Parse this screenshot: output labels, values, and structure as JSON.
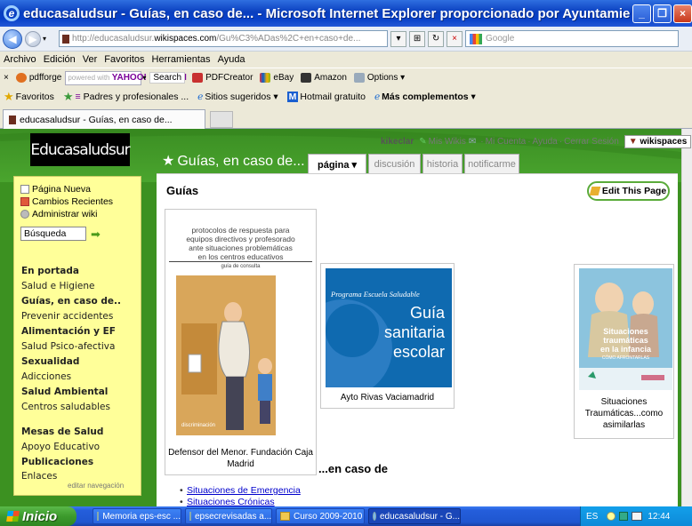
{
  "window": {
    "title": "educasaludsur - Guías, en caso de... - Microsoft Internet Explorer proporcionado por Ayuntamiento ..."
  },
  "address_bar": {
    "url_prefix": "http://educasaludsur.",
    "url_domain": "wikispaces.com",
    "url_rest": "/Gu%C3%ADas%2C+en+caso+de...",
    "search_placeholder": "Google"
  },
  "menu": [
    "Archivo",
    "Edición",
    "Ver",
    "Favoritos",
    "Herramientas",
    "Ayuda"
  ],
  "toolbar": {
    "close_glyph": "×",
    "pdfforge": "pdfforge",
    "yahoo_search_hint": "powered with",
    "yahoo_brand": "YAHOO! SEARCH",
    "search_button": "Search",
    "pdfcreator": "PDFCreator",
    "ebay": "eBay",
    "amazon": "Amazon",
    "options": "Options"
  },
  "favorites_bar": {
    "favoritos": "Favoritos",
    "padres": "Padres y profesionales ...",
    "sitios": "Sitios sugeridos",
    "hotmail": "Hotmail gratuito",
    "mas": "Más complementos"
  },
  "browser_tab": {
    "label": "educasaludsur - Guías, en caso de..."
  },
  "site": {
    "logo": "Educasaludsur",
    "username": "kikeclar",
    "links": [
      "Mis Wikis",
      "Mi Cuenta",
      "Ayuda",
      "Cerrar Sesión"
    ],
    "badge": "wikispaces",
    "page_heading": "Guías, en caso de...",
    "tabs": [
      {
        "label": "página ▾",
        "active": true
      },
      {
        "label": "discusión",
        "active": false
      },
      {
        "label": "historia",
        "active": false
      },
      {
        "label": "notificarme",
        "active": false
      }
    ]
  },
  "sidebar": {
    "tools": [
      "Página Nueva",
      "Cambios Recientes",
      "Administrar wiki"
    ],
    "search_value": "Búsqueda",
    "nav": [
      {
        "label": "En portada",
        "style": "b"
      },
      {
        "label": "Salud e Higiene",
        "style": "c"
      },
      {
        "label": "Guías, en caso de..",
        "style": "b"
      },
      {
        "label": "Prevenir accidentes",
        "style": "c"
      },
      {
        "label": "Alimentación y EF",
        "style": "b"
      },
      {
        "label": "Salud Psico-afectiva",
        "style": "c"
      },
      {
        "label": "Sexualidad",
        "style": "b"
      },
      {
        "label": "Adicciones",
        "style": "c"
      },
      {
        "label": "Salud Ambiental",
        "style": "b"
      },
      {
        "label": "Centros saludables",
        "style": "c"
      },
      {
        "label": "Mesas de Salud",
        "style": "b"
      },
      {
        "label": "Apoyo Educativo",
        "style": "c"
      },
      {
        "label": "Publicaciones",
        "style": "b"
      },
      {
        "label": "Enlaces",
        "style": "c"
      }
    ],
    "edit_nav": "editar navegación"
  },
  "content": {
    "section_title": "Guías",
    "edit_button": "Edit This Page",
    "card1": {
      "cover_lines": [
        "protocolos de respuesta para",
        "equipos directivos y profesorado",
        "ante situaciones problemáticas",
        "en los centros educativos"
      ],
      "cover_sub": "guía de consulta",
      "caption": "Defensor del Menor. Fundación Caja Madrid"
    },
    "card2": {
      "program": "Programa Escuela Saludable",
      "big": [
        "Guía",
        "sanitaria",
        "escolar"
      ],
      "caption": "Ayto Rivas Vaciamadrid"
    },
    "card3": {
      "cover_lines": [
        "Situaciones",
        "traumáticas",
        "en la infancia"
      ],
      "cover_sub": "CÓMO AFRONTARLAS",
      "caption": "Situaciones Traumáticas...como asimilarlas"
    },
    "subsection_title": "...en caso de",
    "links": [
      "Situaciones de Emergencia",
      "Situaciones Crónicas"
    ]
  },
  "taskbar": {
    "start": "Inicio",
    "tasks": [
      {
        "label": "Memoria eps-esc ...",
        "active": false
      },
      {
        "label": "epsecrevisadas  a...",
        "active": false
      },
      {
        "label": "Curso 2009-2010",
        "active": false
      },
      {
        "label": "educasaludsur - G...",
        "active": true
      }
    ],
    "lang": "ES",
    "clock": "12:44"
  }
}
